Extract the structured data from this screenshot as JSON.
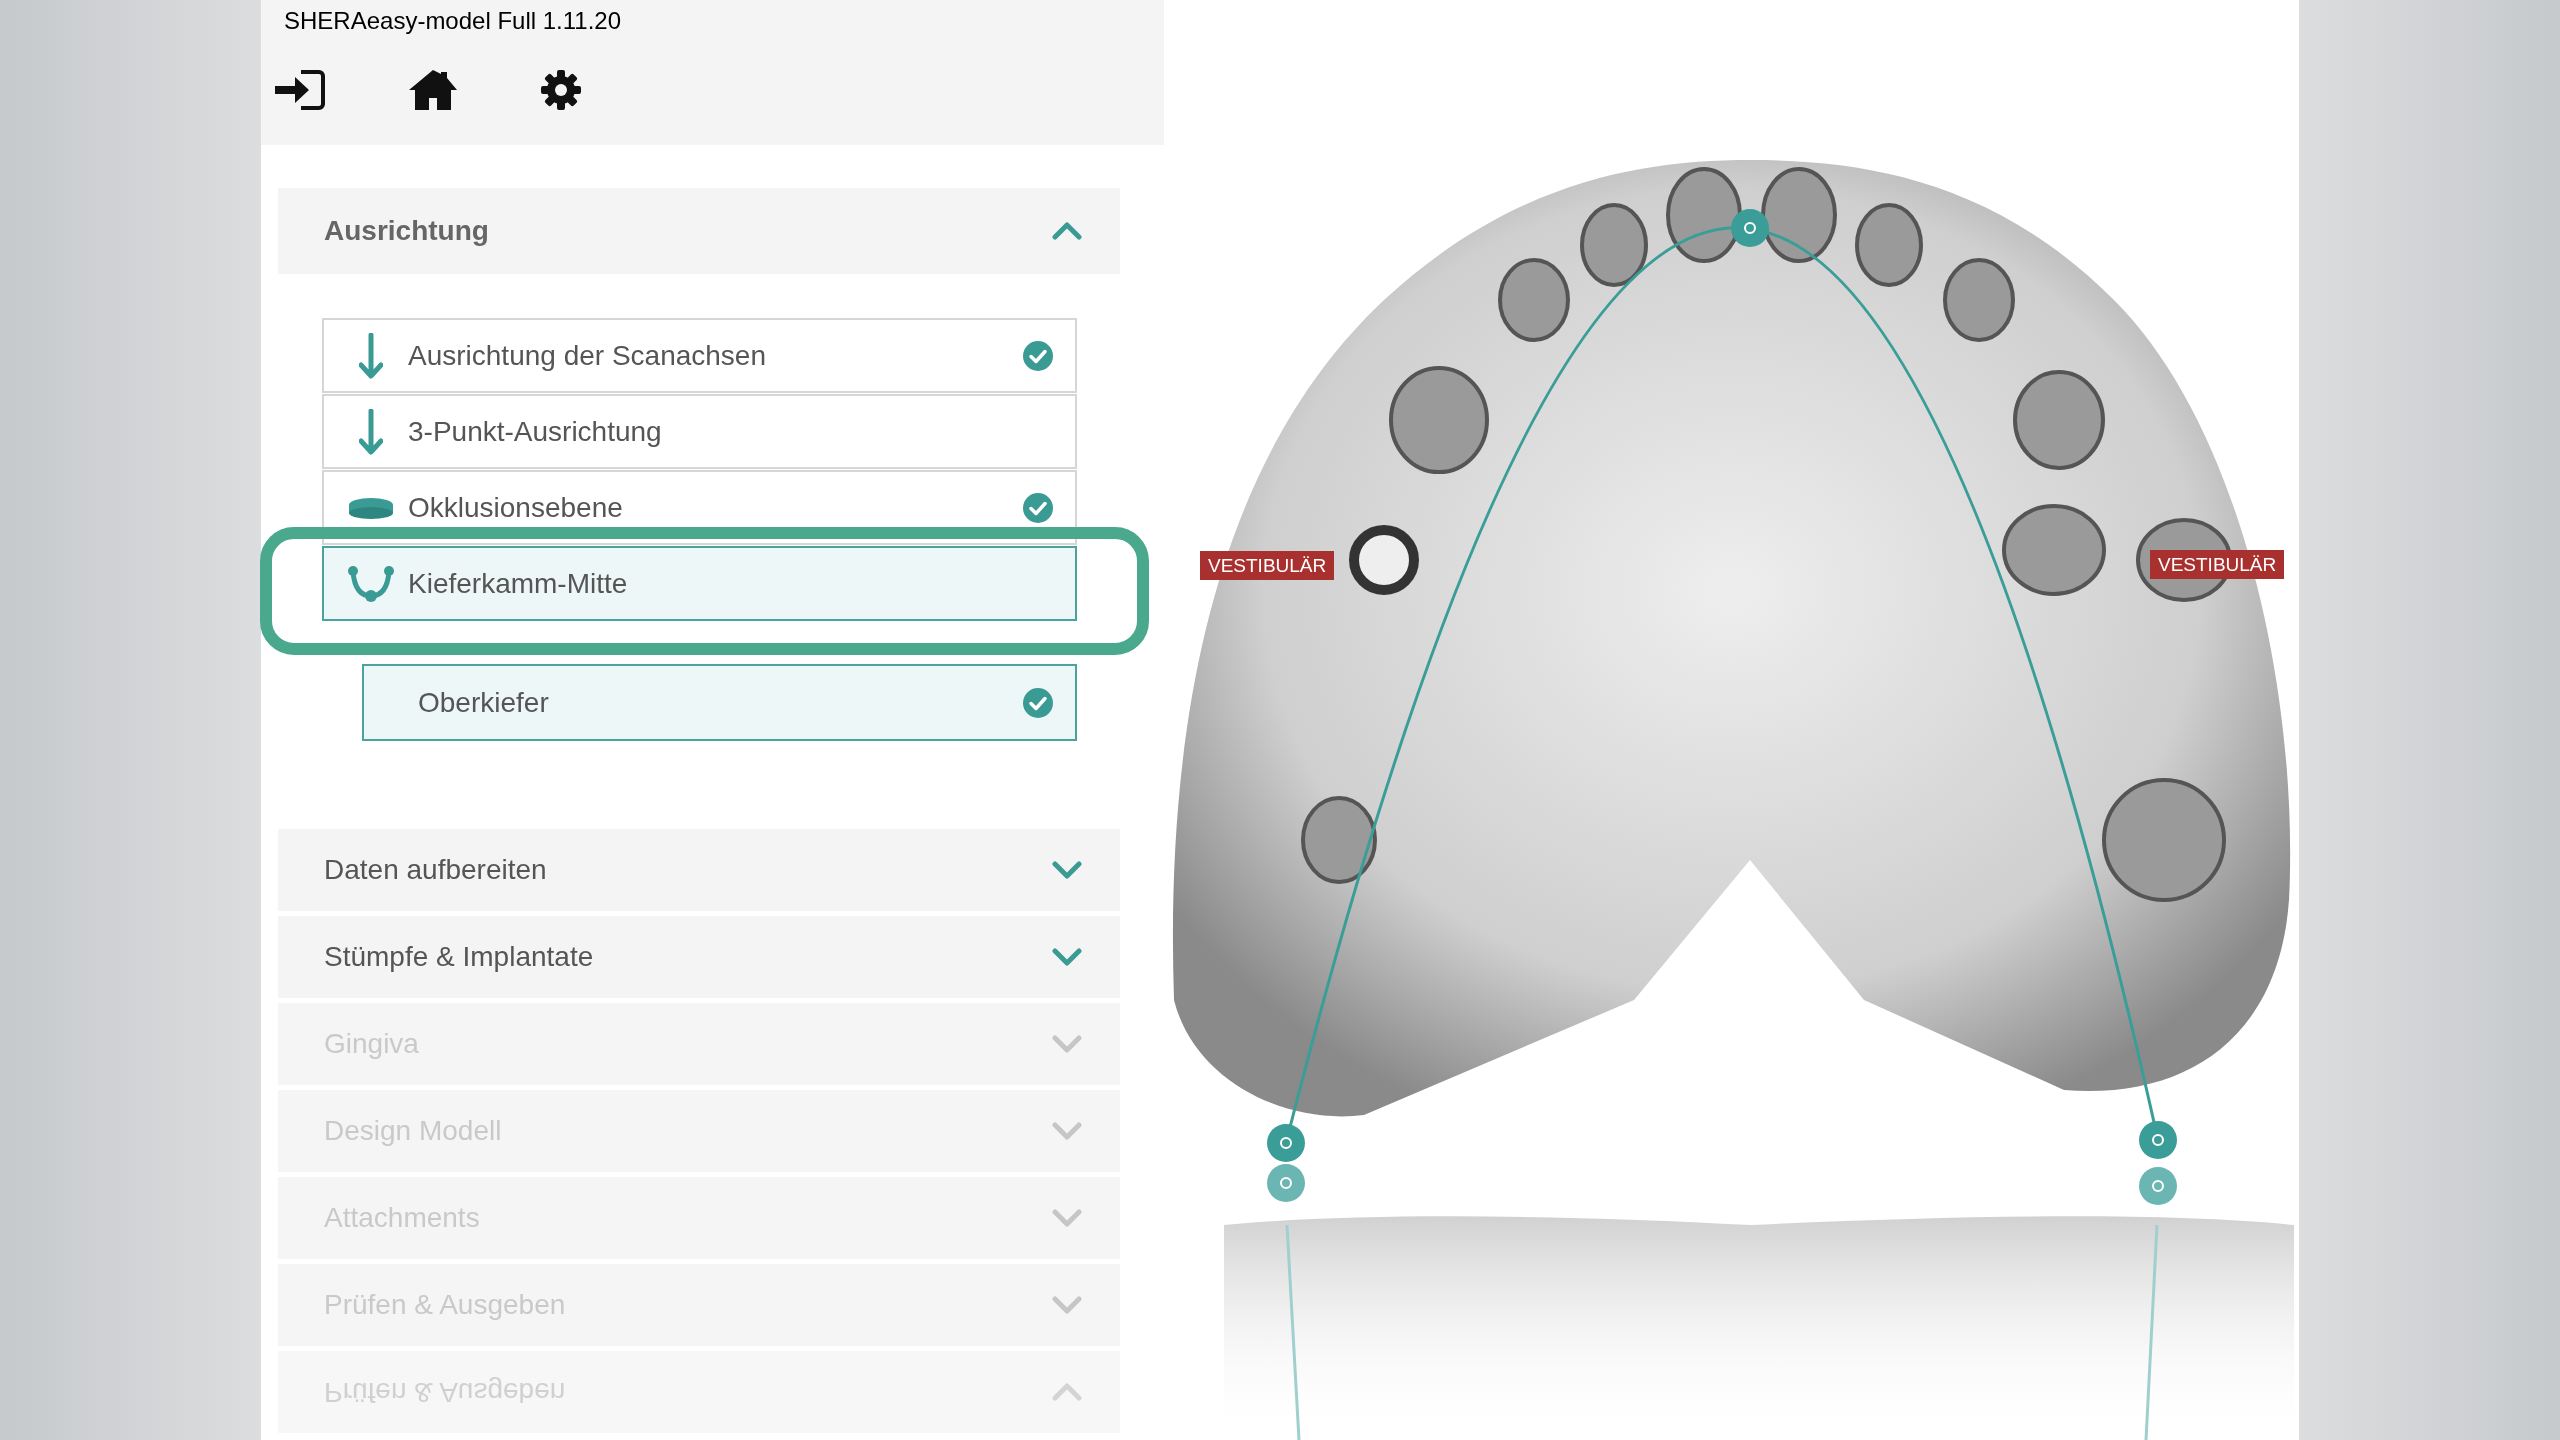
{
  "window": {
    "title": "SHERAeasy-model Full 1.11.20"
  },
  "sections": [
    {
      "label": "Ausrichtung",
      "expanded": true,
      "disabled": false,
      "steps": [
        {
          "label": "Ausrichtung der Scanachsen",
          "kind": "arrow",
          "done": true,
          "selected": false,
          "highlighted": false
        },
        {
          "label": "3-Punkt-Ausrichtung",
          "kind": "arrow",
          "done": false,
          "selected": false,
          "highlighted": false
        },
        {
          "label": "Okklusionsebene",
          "kind": "disc",
          "done": true,
          "selected": false,
          "highlighted": false
        },
        {
          "label": "Kieferkamm-Mitte",
          "kind": "arch",
          "done": false,
          "selected": true,
          "highlighted": true,
          "children": [
            {
              "label": "Oberkiefer",
              "done": true,
              "selected": true
            }
          ]
        }
      ]
    },
    {
      "label": "Daten aufbereiten",
      "expanded": false,
      "disabled": false
    },
    {
      "label": "Stümpfe & Implantate",
      "expanded": false,
      "disabled": false
    },
    {
      "label": "Gingiva",
      "expanded": false,
      "disabled": true
    },
    {
      "label": "Design Modell",
      "expanded": false,
      "disabled": true
    },
    {
      "label": "Attachments",
      "expanded": false,
      "disabled": true
    },
    {
      "label": "Prüfen & Ausgeben",
      "expanded": false,
      "disabled": true
    }
  ],
  "reflection": {
    "label": "Prüfen & Ausgeben"
  },
  "viewport": {
    "labels": [
      "VESTIBULÄR",
      "VESTIBULÄR"
    ]
  }
}
